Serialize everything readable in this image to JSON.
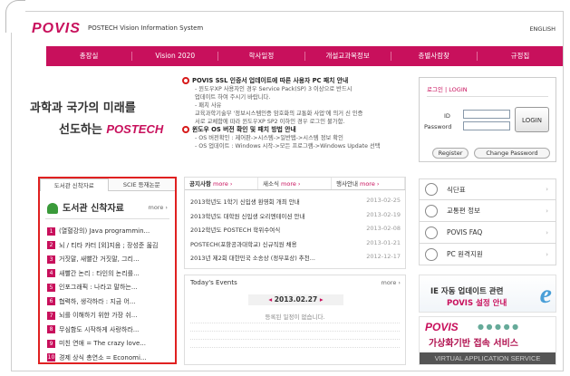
{
  "header": {
    "logo": "POVIS",
    "subtitle": "POSTECH Vision Information System",
    "lang_link": "ENGLISH"
  },
  "nav": [
    "총장실",
    "Vision 2020",
    "학사일정",
    "개설교과목정보",
    "층별사람찾",
    "규정집"
  ],
  "slogan": {
    "line1": "과학과 국가의 미래를",
    "line2_prefix": "선도하는",
    "line2_highlight": "POSTECH"
  },
  "notice": {
    "item1_title": "POVIS SSL 인증서 업데이트에 따른 사용자 PC 패치 안내",
    "item1_line2": "- 윈도우XP 사용자인 경우 Service Pack(SP) 3 이상으로 반드시",
    "item1_line3": "업데이트 하여 주시기 바랍니다.",
    "item1_line4": "- 패치 사유",
    "item1_line5": "교육과학기술부 '정보시스템인증 암호화의 교통화 사업'에 의거 신 인증",
    "item1_line6": "서로 교체함에 따라 윈도우XP SP2 이하인 경우 로그인 불가함.",
    "item2_title": "윈도우 OS 버전 확인 및 패치 방법 안내",
    "item2_line2": "- OS 버전확인 : 제어판->시스템->일반탭->시스템 정보 확인",
    "item2_line3": "- OS 업데이트 : Windows 시작->모든 프로그램->Windows Update 선택"
  },
  "login": {
    "title_ko": "로그인",
    "title_en": "LOGIN",
    "id_label": "ID",
    "pw_label": "Password",
    "login_button": "LOGIN",
    "register_button": "Register",
    "change_pw_button": "Change Password"
  },
  "library": {
    "tab1": "도서관 신착자료",
    "tab2": "SCIE 등재논문",
    "title": "도서관 신착자료",
    "more": "more ›",
    "items": [
      {
        "num": "1",
        "text": "(열혈강의) Java programmin..."
      },
      {
        "num": "2",
        "text": "뇌 / 티타 카터 [외]지음 ; 장성준 옮김"
      },
      {
        "num": "3",
        "text": "거짓말, 새빨간 거짓말, 그리..."
      },
      {
        "num": "4",
        "text": "새빨간 논리 : 타인의 논리를..."
      },
      {
        "num": "5",
        "text": "인포그래픽 : 나라고 말하는..."
      },
      {
        "num": "6",
        "text": "협력하, 생각하라 : 지금 어..."
      },
      {
        "num": "7",
        "text": "뇌를 이해하기 위한 가장 쉬..."
      },
      {
        "num": "8",
        "text": "무심함도 시작하게 사랑하라..."
      },
      {
        "num": "9",
        "text": "미친 연애 = The crazy love..."
      },
      {
        "num": "10",
        "text": "경제 상식 총연소 = Economi..."
      }
    ]
  },
  "board": {
    "tabs": [
      {
        "label": "공지사항",
        "more": "more ›"
      },
      {
        "label": "새소식",
        "more": "more ›"
      },
      {
        "label": "행사안내",
        "more": "more ›"
      }
    ],
    "items": [
      {
        "title": "2013학년도 1학기 신입생 환영회 개최 안내",
        "date": "2013-02-25"
      },
      {
        "title": "2013학년도 대학원 신입생 오리엔테이션 안내",
        "date": "2013-02-19"
      },
      {
        "title": "2012학년도 POSTECH 학위수여식",
        "date": "2013-02-08"
      },
      {
        "title": "POSTECH(포항공과대학교) 신규직원 채용",
        "date": "2013-01-21"
      },
      {
        "title": "2013년 제2회 대한민국 소송상 (정부포상) 추천...",
        "date": "2012-12-17"
      }
    ]
  },
  "events": {
    "title": "Today's Events",
    "more": "more ›",
    "date": "2013.02.27",
    "prev": "◂",
    "next": "▸",
    "empty_text": "등록된 일정이 없습니다."
  },
  "quick_links": [
    {
      "label": "식단표",
      "icon": "menu-icon"
    },
    {
      "label": "교통편 정보",
      "icon": "bus-icon"
    },
    {
      "label": "POVIS FAQ",
      "icon": "faq-icon"
    },
    {
      "label": "PC 원격지원",
      "icon": "monitor-icon"
    }
  ],
  "banner_ie": {
    "line1": "IE 자동 업데이트 관련",
    "line2": "POVIS 설정 안내",
    "letter": "e"
  },
  "banner_vas": {
    "logo": "POVIS",
    "line1": "가상화기반 접속 서비스",
    "line2": "VIRTUAL APPLICATION SERVICE"
  },
  "colors": {
    "brand": "#c8105c",
    "highlight_border": "#e02020"
  }
}
